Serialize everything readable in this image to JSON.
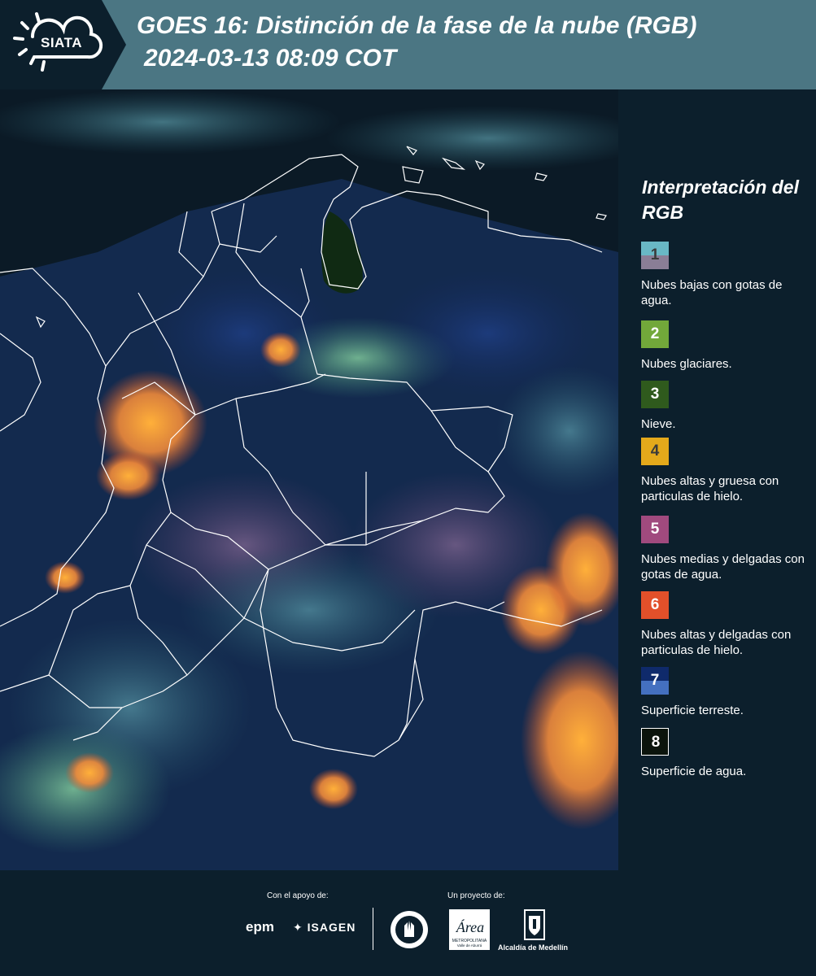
{
  "header": {
    "logo_text": "SIATA",
    "title": "GOES 16: Distinción de la fase de la nube (RGB)",
    "subtitle": "2024-03-13 08:09 COT"
  },
  "legend": {
    "title": "Interpretación del RGB",
    "items": [
      {
        "number": "1",
        "label": "Nubes bajas con gotas de agua.",
        "colors": [
          "#69b8c5",
          "#8a7e96"
        ],
        "text_color": "#3a3a3a"
      },
      {
        "number": "2",
        "label": "Nubes glaciares.",
        "colors": [
          "#72a83a"
        ],
        "text_color": "#ffffff"
      },
      {
        "number": "3",
        "label": "Nieve.",
        "colors": [
          "#2f5a1d"
        ],
        "text_color": "#ffffff"
      },
      {
        "number": "4",
        "label": "Nubes altas y gruesa con particulas de hielo.",
        "colors": [
          "#e4a91b"
        ],
        "text_color": "#3a3a3a"
      },
      {
        "number": "5",
        "label": "Nubes medias y delgadas con gotas de agua.",
        "colors": [
          "#a04a7e"
        ],
        "text_color": "#ffffff"
      },
      {
        "number": "6",
        "label": "Nubes altas y delgadas con particulas de hielo.",
        "colors": [
          "#e2502a"
        ],
        "text_color": "#ffffff"
      },
      {
        "number": "7",
        "label": "Superficie terreste.",
        "colors": [
          "#0f2a6b",
          "#4470c0"
        ],
        "text_color": "#ffffff"
      },
      {
        "number": "8",
        "label": "Superficie de agua.",
        "colors": [
          "#0b140c"
        ],
        "text_color": "#ffffff",
        "border": "#ffffff"
      }
    ]
  },
  "footer": {
    "support_label": "Con el apoyo de:",
    "project_label": "Un proyecto de:",
    "sponsor_1": "epm",
    "sponsor_2": "ISAGEN",
    "area_logo_text": "Área",
    "area_logo_sub": "METROPOLITANA",
    "area_logo_sub2": "Valle de Aburrá",
    "alcaldia": "Alcaldía de Medellín"
  }
}
